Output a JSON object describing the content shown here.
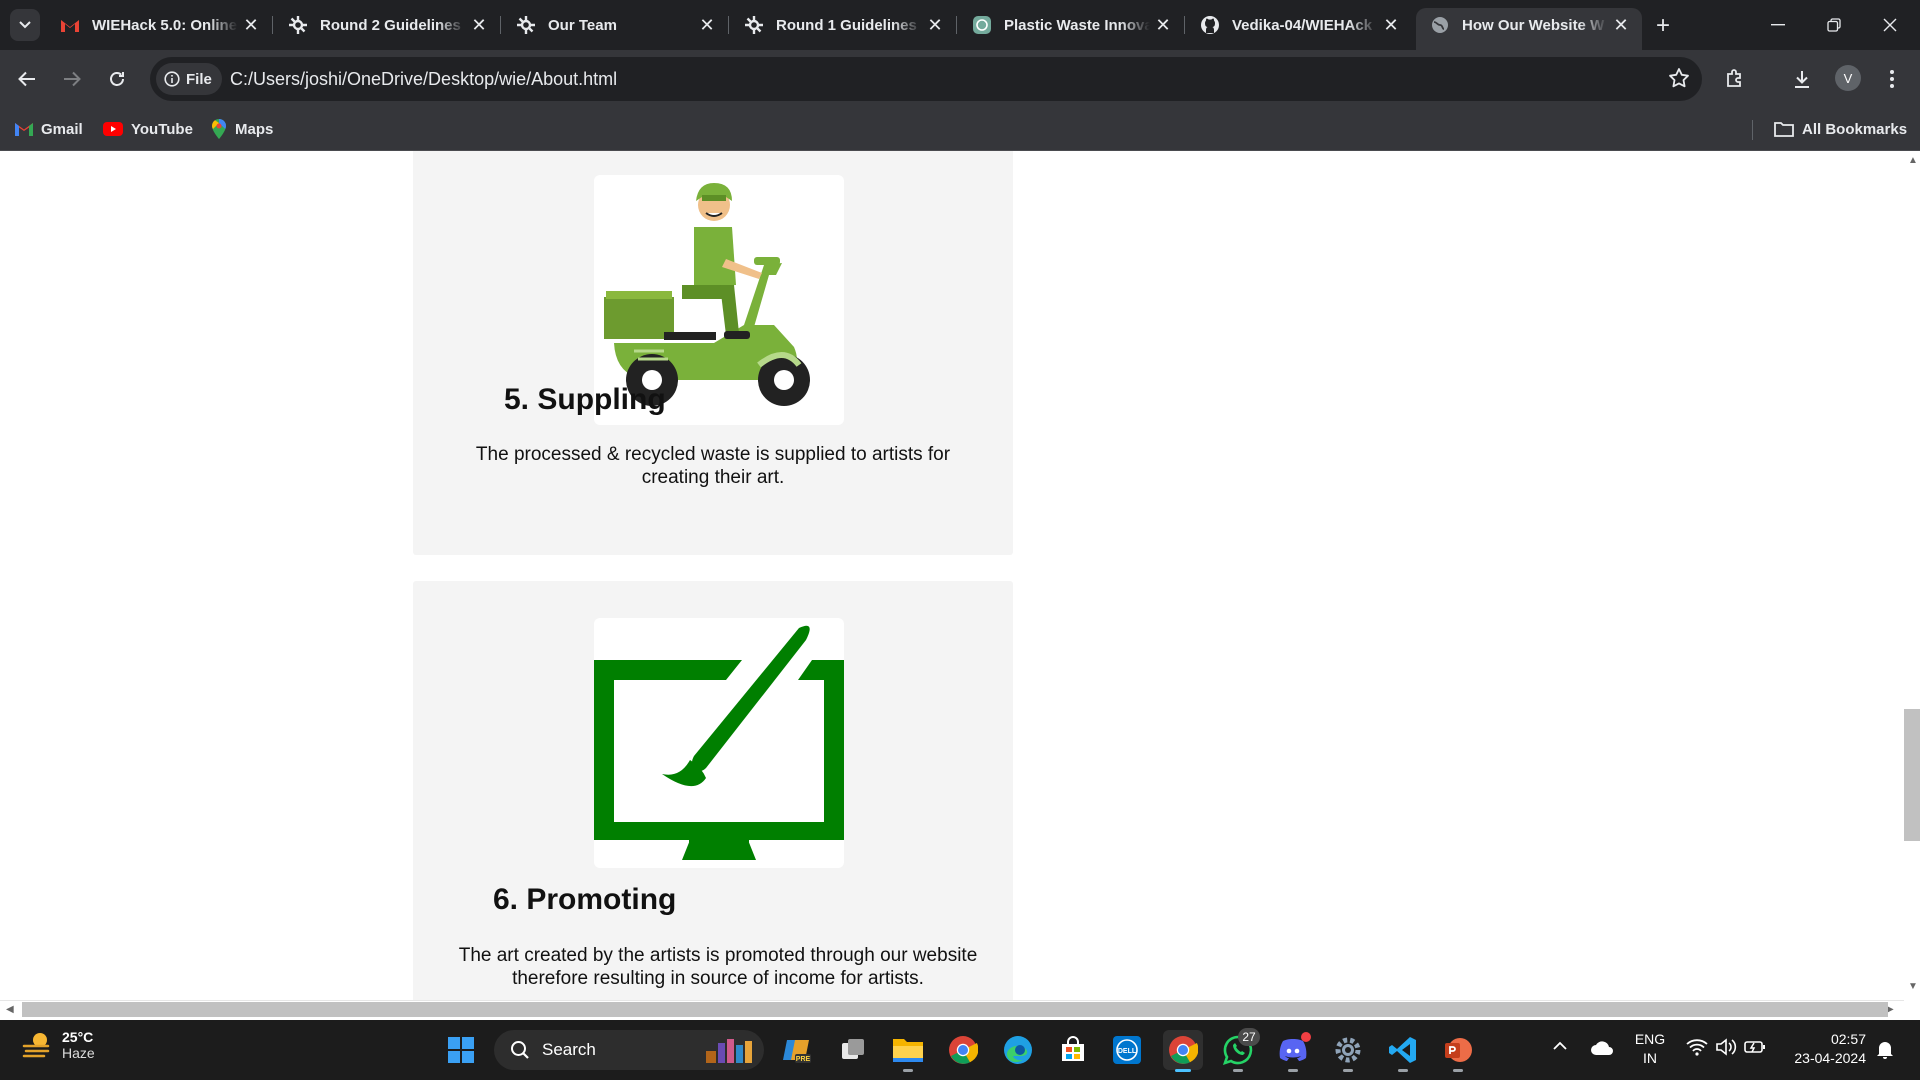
{
  "browser": {
    "tabs": [
      {
        "title": "WIEHack 5.0: Online",
        "favicon": "gmail-icon"
      },
      {
        "title": "Round 2 Guidelines",
        "favicon": "unstop-icon"
      },
      {
        "title": "Our Team",
        "favicon": "unstop-icon"
      },
      {
        "title": "Round 1 Guidelines",
        "favicon": "unstop-icon"
      },
      {
        "title": "Plastic Waste Innova",
        "favicon": "chatgpt-icon"
      },
      {
        "title": "Vedika-04/WIEHAck",
        "favicon": "github-icon"
      },
      {
        "title": "How Our Website W",
        "favicon": "globe-icon",
        "active": true
      }
    ],
    "omnibox": {
      "chip": "File",
      "url": "C:/Users/joshi/OneDrive/Desktop/wie/About.html"
    },
    "profile_initial": "V",
    "bookmarks": [
      {
        "label": "Gmail",
        "icon": "gmail-icon"
      },
      {
        "label": "YouTube",
        "icon": "youtube-icon"
      },
      {
        "label": "Maps",
        "icon": "maps-icon"
      }
    ],
    "all_bookmarks": "All Bookmarks"
  },
  "page": {
    "cards": [
      {
        "title": "5. Suppling",
        "text": "The processed & recycled waste is supplied to artists for creating their art.",
        "image": "delivery-scooter-illustration"
      },
      {
        "title": "6. Promoting",
        "text": "The art created by the artists is promoted through our website therefore resulting in source of income for artists.",
        "image": "monitor-paintbrush-icon"
      }
    ],
    "accent_color": "#007f00"
  },
  "taskbar": {
    "weather": {
      "temp": "25°C",
      "cond": "Haze"
    },
    "search_placeholder": "Search",
    "whatsapp_badge": "27",
    "lang": {
      "l1": "ENG",
      "l2": "IN"
    },
    "clock": {
      "time": "02:57",
      "date": "23-04-2024"
    }
  }
}
